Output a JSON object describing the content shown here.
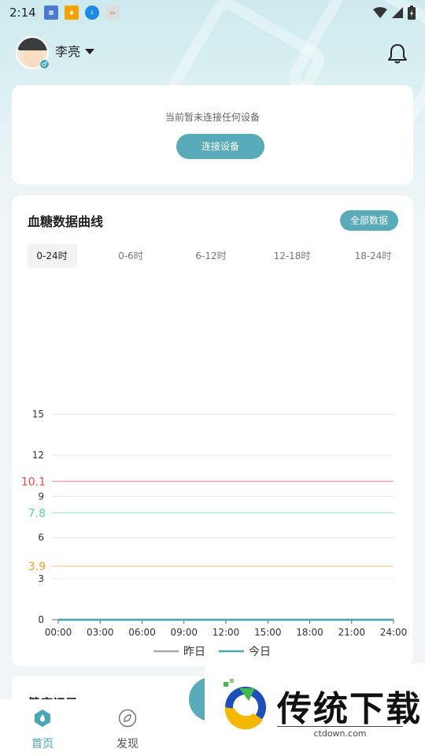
{
  "status_bar": {
    "time": "2:14"
  },
  "header": {
    "user_name": "李亮"
  },
  "device_card": {
    "message": "当前暂未连接任何设备",
    "connect_label": "连接设备"
  },
  "glucose_card": {
    "title": "血糖数据曲线",
    "all_data_label": "全部数据",
    "tabs": [
      {
        "label": "0-24时",
        "active": true
      },
      {
        "label": "0-6时",
        "active": false
      },
      {
        "label": "6-12时",
        "active": false
      },
      {
        "label": "12-18时",
        "active": false
      },
      {
        "label": "18-24时",
        "active": false
      }
    ]
  },
  "chart_data": {
    "type": "line",
    "x_ticks": [
      "00:00",
      "03:00",
      "06:00",
      "09:00",
      "12:00",
      "15:00",
      "18:00",
      "21:00",
      "24:00"
    ],
    "xlim": [
      0,
      24
    ],
    "ylim": [
      0,
      15
    ],
    "y_ticks": [
      0,
      3,
      6,
      9,
      12,
      15
    ],
    "reference_lines": [
      {
        "value": 10.1,
        "label": "10.1",
        "color": "#e5484d"
      },
      {
        "value": 7.8,
        "label": "7.8",
        "color": "#5fd0a8"
      },
      {
        "value": 3.9,
        "label": "3.9",
        "color": "#f0a030"
      }
    ],
    "series": [
      {
        "name": "昨日",
        "color": "#aaaaaa",
        "x": [
          0,
          24
        ],
        "y": [
          0,
          0
        ]
      },
      {
        "name": "今日",
        "color": "#4aa6b7",
        "x": [
          0,
          24
        ],
        "y": [
          0,
          0
        ]
      }
    ],
    "grid": true,
    "legend": "bottom-center"
  },
  "records_card": {
    "title": "健康记录"
  },
  "tabbar": {
    "items": [
      {
        "label": "首页",
        "icon": "water-drop-icon",
        "active": true
      },
      {
        "label": "发现",
        "icon": "leaf-icon",
        "active": false
      }
    ]
  },
  "watermark": {
    "title": "传统下载",
    "url": "ctdown.com"
  },
  "colors": {
    "accent": "#5aabb9",
    "active_tab": "#4aa6b7"
  }
}
